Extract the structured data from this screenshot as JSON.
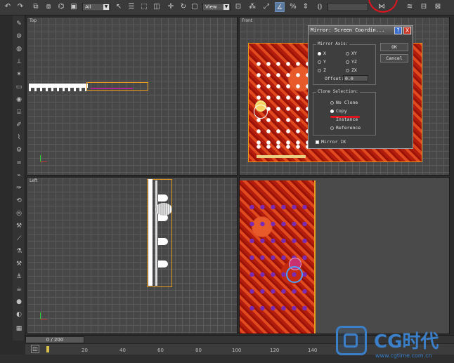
{
  "toolbar": {
    "selection_filter": "All",
    "reference_coord": "View",
    "icons": [
      "undo-icon",
      "redo-icon",
      "select-link-icon",
      "unlink-icon",
      "bind-space-warp-icon",
      "select-icon",
      "select-by-name-icon",
      "rect-region-icon",
      "window-crossing-icon",
      "move-icon",
      "rotate-icon",
      "scale-icon",
      "pivot-icon",
      "snap-icon",
      "angle-snap-icon",
      "percent-snap-icon",
      "spinner-snap-icon",
      "named-selection-icon",
      "mirror-icon",
      "align-icon",
      "layer-icon"
    ],
    "accent_circle_color": "#e0141e"
  },
  "viewports": {
    "top": {
      "label": "Top"
    },
    "front": {
      "label": "Front"
    },
    "left": {
      "label": "Left"
    },
    "perspective": {
      "label": ""
    }
  },
  "dialog": {
    "title": "Mirror: Screen Coordin...",
    "help_label": "?",
    "close_label": "X",
    "mirror_axis": {
      "title": "Mirror Axis:",
      "options": [
        "X",
        "Y",
        "Z",
        "XY",
        "YZ",
        "ZX"
      ],
      "selected": "X",
      "offset_label": "Offset:",
      "offset_value": "0.0"
    },
    "clone_selection": {
      "title": "Clone Selection:",
      "options": [
        "No Clone",
        "Copy",
        "Instance",
        "Reference"
      ],
      "selected": "Copy"
    },
    "mirror_ik_label": "Mirror IK",
    "ok_label": "OK",
    "cancel_label": "Cancel",
    "underline_color": "#e0141e"
  },
  "timeline": {
    "frame_counter": "0 / 200"
  },
  "ruler": {
    "ticks": [
      "20",
      "40",
      "60",
      "80",
      "100",
      "120",
      "140"
    ]
  },
  "watermark": {
    "brand": "CG时代",
    "url": "www.cgtime.com.cn",
    "color": "#3a7fc8"
  }
}
